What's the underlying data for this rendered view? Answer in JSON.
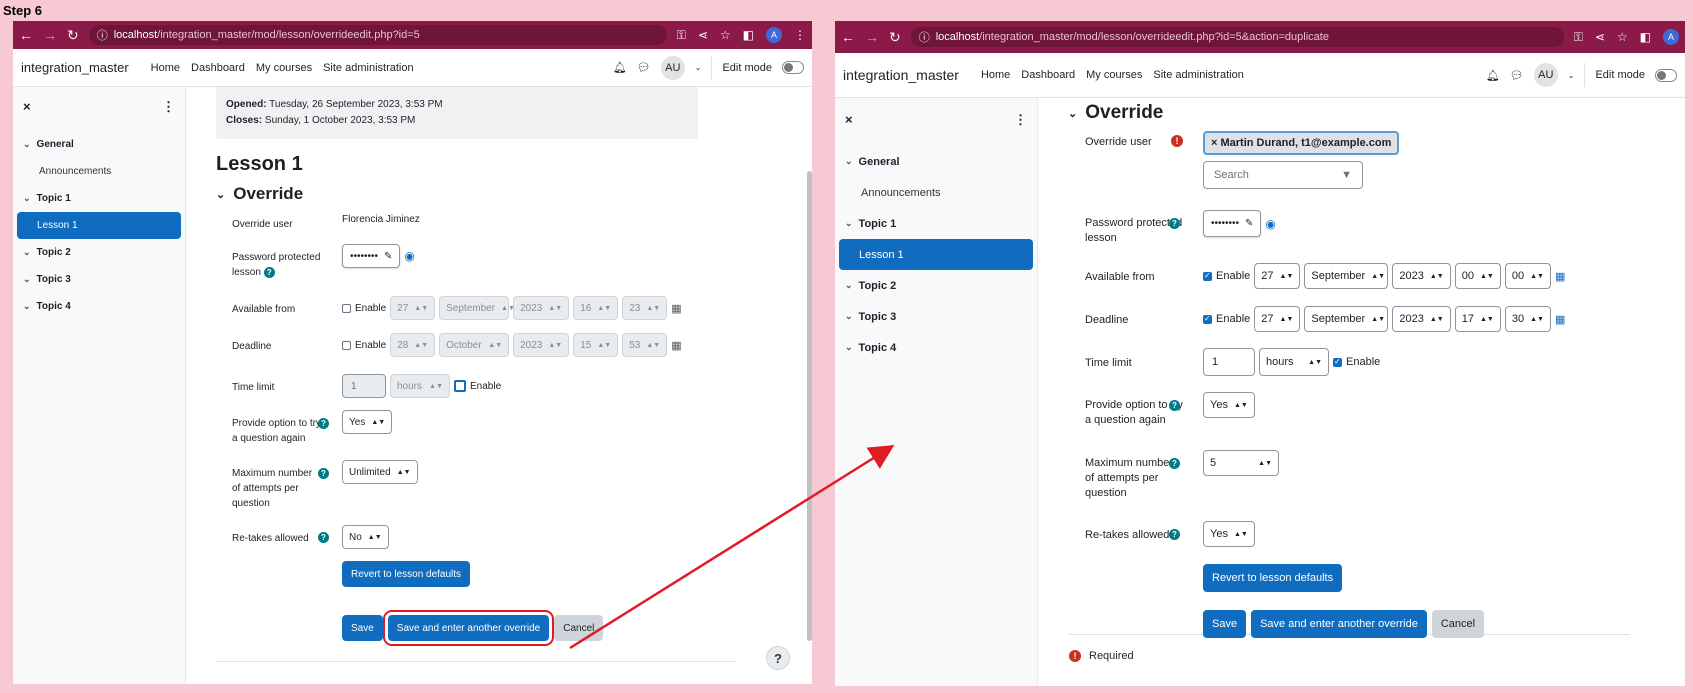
{
  "step_label": "Step 6",
  "left": {
    "url_host": "localhost",
    "url_path": "/integration_master/mod/lesson/overrideedit.php?id=5",
    "brand": "integration_master",
    "menu": [
      "Home",
      "Dashboard",
      "My courses",
      "Site administration"
    ],
    "avatar": "AU",
    "edit_mode": "Edit mode",
    "drawer": {
      "close": "×",
      "items": [
        {
          "label": "General",
          "type": "section"
        },
        {
          "label": "Announcements",
          "type": "sub"
        },
        {
          "label": "Topic 1",
          "type": "section"
        },
        {
          "label": "Lesson 1",
          "type": "active"
        },
        {
          "label": "Topic 2",
          "type": "section"
        },
        {
          "label": "Topic 3",
          "type": "section"
        },
        {
          "label": "Topic 4",
          "type": "section"
        }
      ]
    },
    "opened_label": "Opened:",
    "opened_value": "Tuesday, 26 September 2023, 3:53 PM",
    "closes_label": "Closes:",
    "closes_value": "Sunday, 1 October 2023, 3:53 PM",
    "lesson_title": "Lesson 1",
    "override_heading": "Override",
    "override_user_label": "Override user",
    "override_user_value": "Florencia Jiminez",
    "password_label": "Password protected lesson",
    "password_mask": "••••••••",
    "available_label": "Available from",
    "available": {
      "enable": "Enable",
      "day": "27",
      "month": "September",
      "year": "2023",
      "hour": "16",
      "minute": "23"
    },
    "deadline_label": "Deadline",
    "deadline": {
      "enable": "Enable",
      "day": "28",
      "month": "October",
      "year": "2023",
      "hour": "15",
      "minute": "53"
    },
    "time_limit_label": "Time limit",
    "time_limit": {
      "value": "1",
      "unit": "hours",
      "enable": "Enable"
    },
    "try_again_label": "Provide option to try a question again",
    "try_again_value": "Yes",
    "max_attempts_label": "Maximum number of attempts per question",
    "max_attempts_value": "Unlimited",
    "retakes_label": "Re-takes allowed",
    "retakes_value": "No",
    "revert_button": "Revert to lesson defaults",
    "save_button": "Save",
    "save_another_button": "Save and enter another override",
    "cancel_button": "Cancel",
    "help_fab": "?"
  },
  "right": {
    "url_host": "localhost",
    "url_path": "/integration_master/mod/lesson/overrideedit.php?id=5&action=duplicate",
    "brand": "integration_master",
    "menu": [
      "Home",
      "Dashboard",
      "My courses",
      "Site administration"
    ],
    "avatar": "AU",
    "edit_mode": "Edit mode",
    "drawer": {
      "close": "×",
      "items": [
        {
          "label": "General",
          "type": "section"
        },
        {
          "label": "Announcements",
          "type": "sub"
        },
        {
          "label": "Topic 1",
          "type": "section"
        },
        {
          "label": "Lesson 1",
          "type": "active"
        },
        {
          "label": "Topic 2",
          "type": "section"
        },
        {
          "label": "Topic 3",
          "type": "section"
        },
        {
          "label": "Topic 4",
          "type": "section"
        }
      ]
    },
    "override_heading": "Override",
    "override_user_label": "Override user",
    "override_user_chip": "× Martin Durand, t1@example.com",
    "search_placeholder": "Search",
    "password_label": "Password protected lesson",
    "password_mask": "••••••••",
    "available_label": "Available from",
    "available": {
      "enable": "Enable",
      "day": "27",
      "month": "September",
      "year": "2023",
      "hour": "00",
      "minute": "00"
    },
    "deadline_label": "Deadline",
    "deadline": {
      "enable": "Enable",
      "day": "27",
      "month": "September",
      "year": "2023",
      "hour": "17",
      "minute": "30"
    },
    "time_limit_label": "Time limit",
    "time_limit": {
      "value": "1",
      "unit": "hours",
      "enable": "Enable"
    },
    "try_again_label": "Provide option to try a question again",
    "try_again_value": "Yes",
    "max_attempts_label": "Maximum number of attempts per question",
    "max_attempts_value": "5",
    "retakes_label": "Re-takes allowed",
    "retakes_value": "Yes",
    "revert_button": "Revert to lesson defaults",
    "save_button": "Save",
    "save_another_button": "Save and enter another override",
    "cancel_button": "Cancel",
    "required_label": "Required"
  },
  "colors": {
    "browser_bar": "#8b1a48",
    "primary": "#0f6cbf",
    "highlight": "#e01b24",
    "background": "#f6c9d3"
  }
}
